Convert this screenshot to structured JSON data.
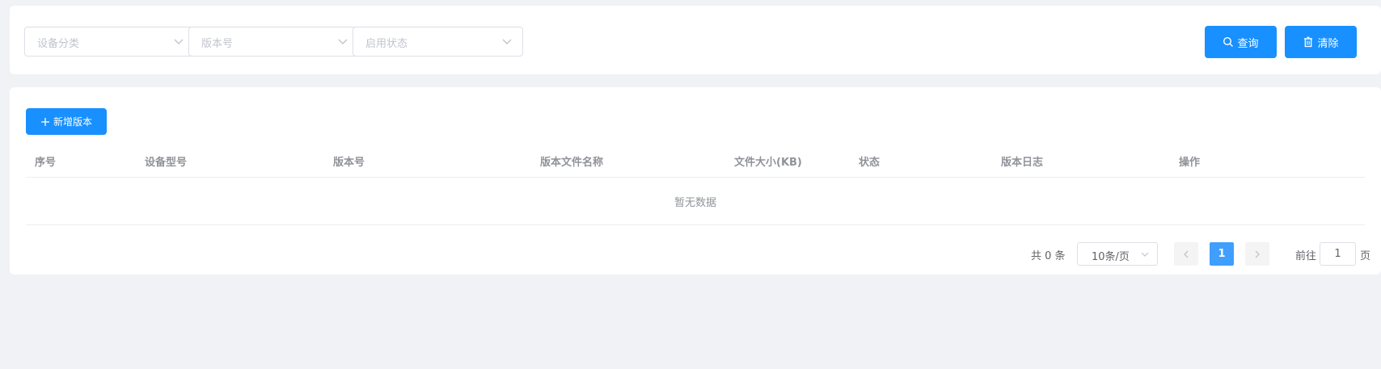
{
  "filters": {
    "device_category_placeholder": "设备分类",
    "version_placeholder": "版本号",
    "status_placeholder": "启用状态",
    "search_label": "查询",
    "clear_label": "清除"
  },
  "toolbar": {
    "add_label": "新增版本"
  },
  "table": {
    "columns": [
      "序号",
      "设备型号",
      "版本号",
      "版本文件名称",
      "文件大小(KB)",
      "状态",
      "版本日志",
      "操作"
    ],
    "empty_text": "暂无数据"
  },
  "pagination": {
    "total_text": "共 0 条",
    "page_size": "10条/页",
    "current_page": "1",
    "goto_label": "前往",
    "goto_value": "1",
    "goto_suffix": "页"
  },
  "colors": {
    "primary": "#1890ff",
    "active_page": "#409eff",
    "background": "#f0f2f5"
  }
}
